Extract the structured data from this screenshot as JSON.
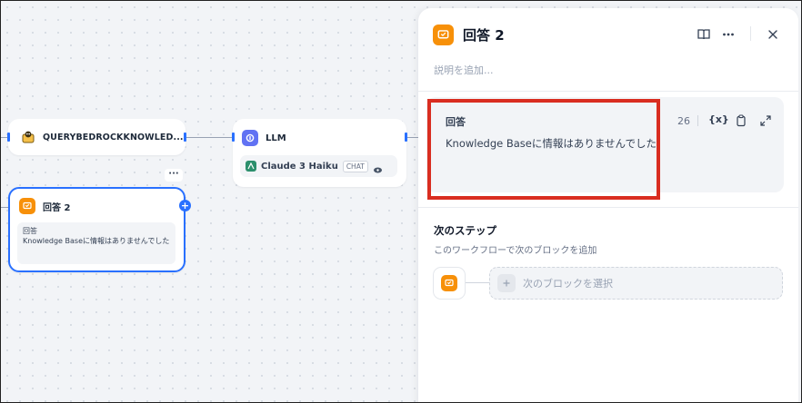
{
  "canvas": {
    "node_kb": {
      "title": "QUERYBEDROCKKNOWLED..."
    },
    "node_llm": {
      "title": "LLM",
      "model": "Claude 3 Haiku",
      "mode_badge": "CHAT"
    },
    "node_answer": {
      "title": "回答 2",
      "more": "···",
      "content_label": "回答",
      "content_text": "Knowledge Baseに情報はありませんでした"
    }
  },
  "panel": {
    "title": "回答 2",
    "description_placeholder": "説明を追加...",
    "field_label": "回答",
    "char_count": "26",
    "variable_button": "{x}",
    "field_value": "Knowledge Baseに情報はありませんでした",
    "next_step_title": "次のステップ",
    "next_step_desc": "このワークフローで次のブロックを追加",
    "select_next_block": "次のブロックを選択"
  },
  "colors": {
    "accent_orange": "#f79009",
    "accent_blue": "#2970ff",
    "llm_indigo": "#6172f3",
    "highlight_red": "#d92d20"
  }
}
